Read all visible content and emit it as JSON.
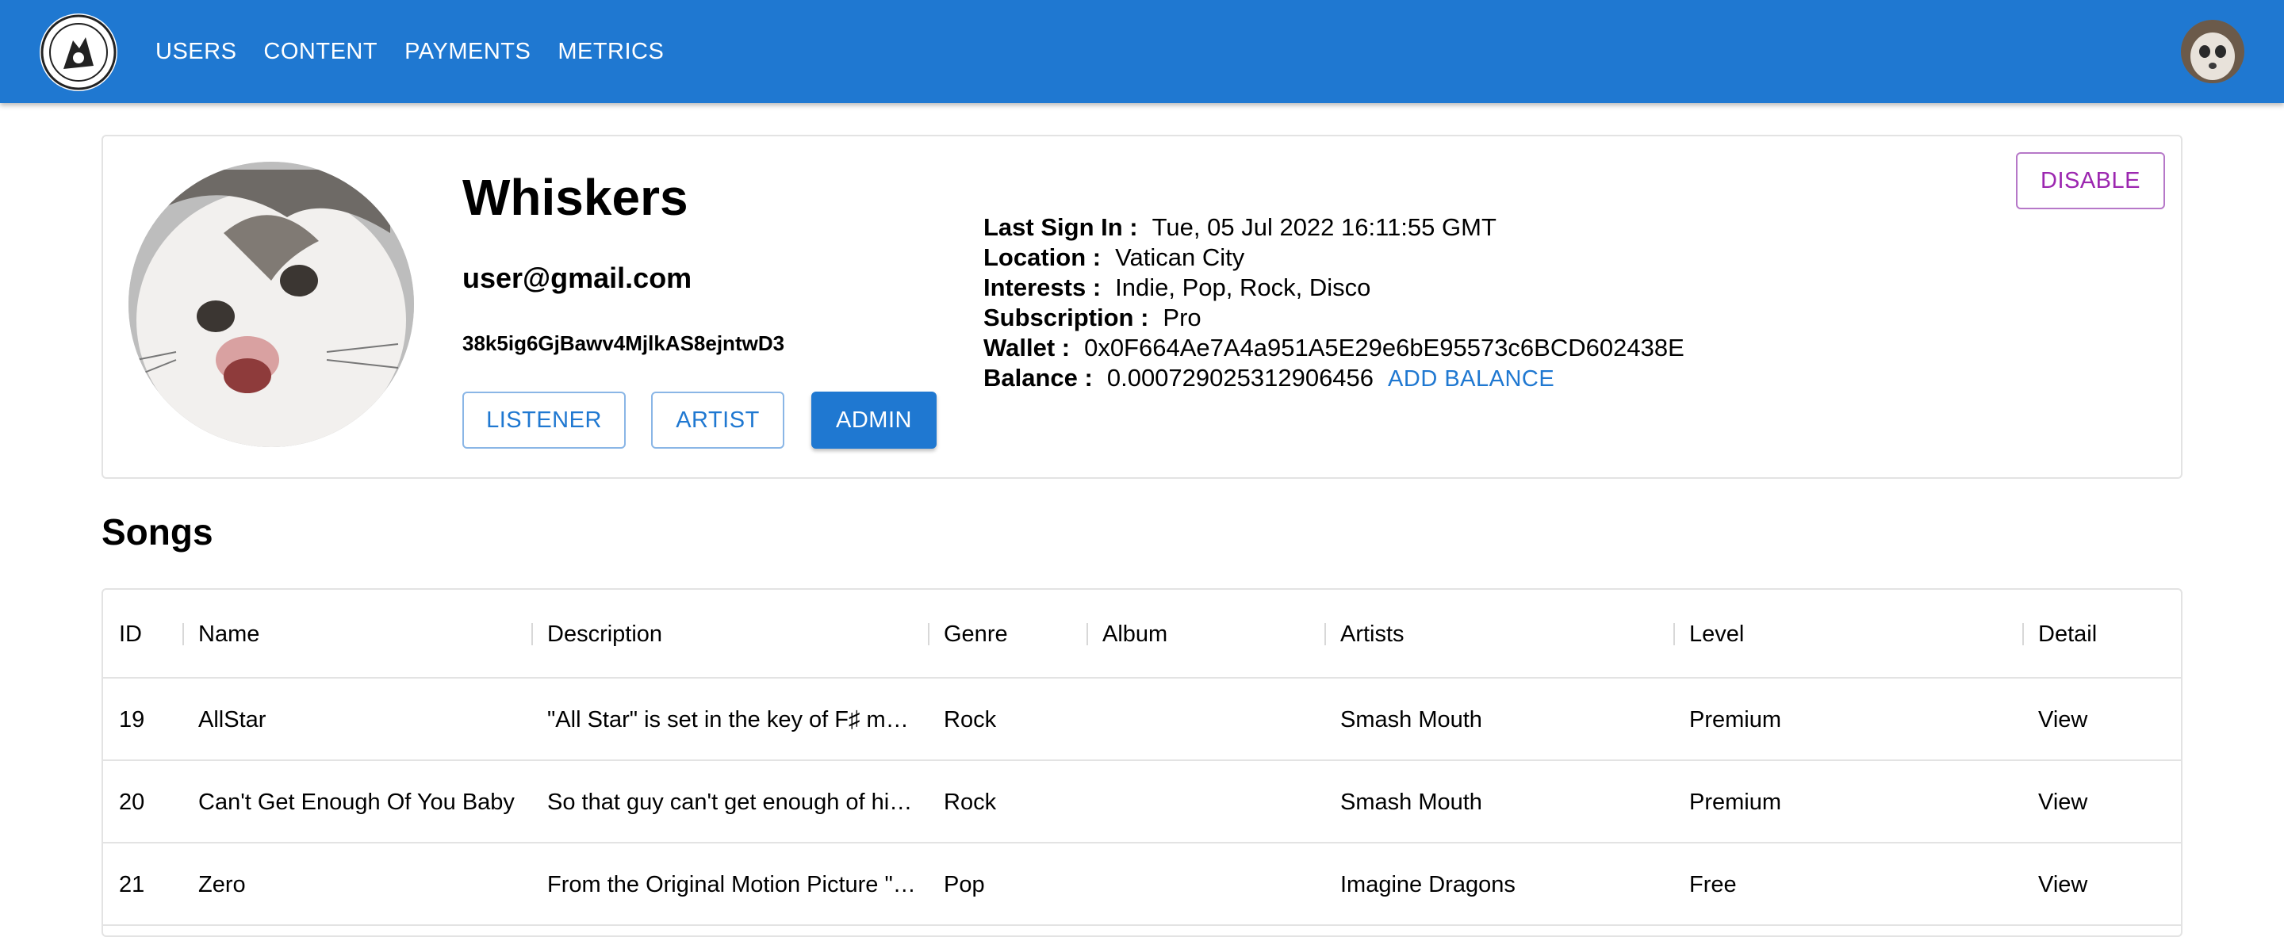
{
  "nav": {
    "items": [
      "USERS",
      "CONTENT",
      "PAYMENTS",
      "METRICS"
    ]
  },
  "profile": {
    "name": "Whiskers",
    "email": "user@gmail.com",
    "uid": "38k5ig6GjBawv4MjlkAS8ejntwD3",
    "roles": {
      "listener": "LISTENER",
      "artist": "ARTIST",
      "admin": "ADMIN"
    },
    "details": {
      "last_sign_in_label": "Last Sign In :",
      "last_sign_in": "Tue, 05 Jul 2022 16:11:55 GMT",
      "location_label": "Location :",
      "location": "Vatican City",
      "interests_label": "Interests :",
      "interests": "Indie, Pop, Rock, Disco",
      "subscription_label": "Subscription :",
      "subscription": "Pro",
      "wallet_label": "Wallet :",
      "wallet": "0x0F664Ae7A4a951A5E29e6bE95573c6BCD602438E",
      "balance_label": "Balance :",
      "balance": "0.000729025312906456",
      "add_balance": "ADD BALANCE"
    },
    "disable_label": "DISABLE"
  },
  "songs": {
    "title": "Songs",
    "columns": [
      "ID",
      "Name",
      "Description",
      "Genre",
      "Album",
      "Artists",
      "Level",
      "Detail"
    ],
    "rows": [
      {
        "id": "19",
        "name": "AllStar",
        "description": "\"All Star\" is set in the key of F♯ m…",
        "genre": "Rock",
        "album": "",
        "artists": "Smash Mouth",
        "level": "Premium",
        "detail": "View"
      },
      {
        "id": "20",
        "name": "Can't Get Enough Of You Baby",
        "description": "So that guy can't get enough of hi…",
        "genre": "Rock",
        "album": "",
        "artists": "Smash Mouth",
        "level": "Premium",
        "detail": "View"
      },
      {
        "id": "21",
        "name": "Zero",
        "description": "From the Original Motion Picture \"…",
        "genre": "Pop",
        "album": "",
        "artists": "Imagine Dragons",
        "level": "Free",
        "detail": "View"
      }
    ]
  },
  "colors": {
    "primary": "#1f78d1",
    "secondary": "#9c27b0"
  }
}
